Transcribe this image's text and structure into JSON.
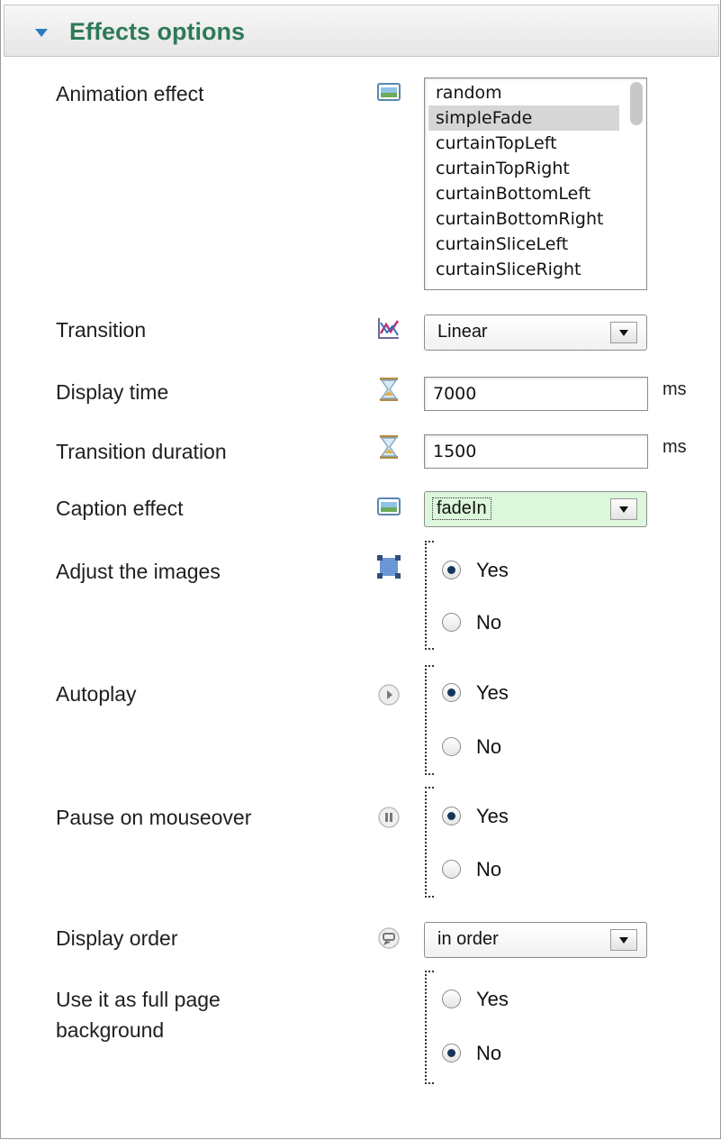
{
  "header": {
    "title": "Effects options"
  },
  "colors": {
    "title_green": "#2e7a58",
    "triangle_blue": "#2a7cc1",
    "caption_select_bg": "#dcf7dc"
  },
  "icons": {
    "animation": "image-icon",
    "transition": "chart-icon",
    "display_time": "hourglass-icon",
    "transition_duration": "hourglass-icon",
    "caption": "image-icon",
    "adjust": "resize-icon",
    "autoplay": "play-icon",
    "pause": "pause-icon",
    "order": "shuffle-icon"
  },
  "fields": {
    "animation_effect": {
      "label": "Animation effect",
      "options": [
        "random",
        "simpleFade",
        "curtainTopLeft",
        "curtainTopRight",
        "curtainBottomLeft",
        "curtainBottomRight",
        "curtainSliceLeft",
        "curtainSliceRight"
      ],
      "selected": "simpleFade"
    },
    "transition": {
      "label": "Transition",
      "value": "Linear"
    },
    "display_time": {
      "label": "Display time",
      "value": "7000",
      "unit": "ms"
    },
    "transition_duration": {
      "label": "Transition duration",
      "value": "1500",
      "unit": "ms"
    },
    "caption_effect": {
      "label": "Caption effect",
      "value": "fadeIn"
    },
    "adjust_images": {
      "label": "Adjust the images",
      "yes": "Yes",
      "no": "No",
      "selected": "Yes"
    },
    "autoplay": {
      "label": "Autoplay",
      "yes": "Yes",
      "no": "No",
      "selected": "Yes"
    },
    "pause_on_mouseover": {
      "label": "Pause on mouseover",
      "yes": "Yes",
      "no": "No",
      "selected": "Yes"
    },
    "display_order": {
      "label": "Display order",
      "value": "in order"
    },
    "full_page_background": {
      "label_line1": "Use it as full page",
      "label_line2": "background",
      "yes": "Yes",
      "no": "No",
      "selected": "No"
    }
  }
}
